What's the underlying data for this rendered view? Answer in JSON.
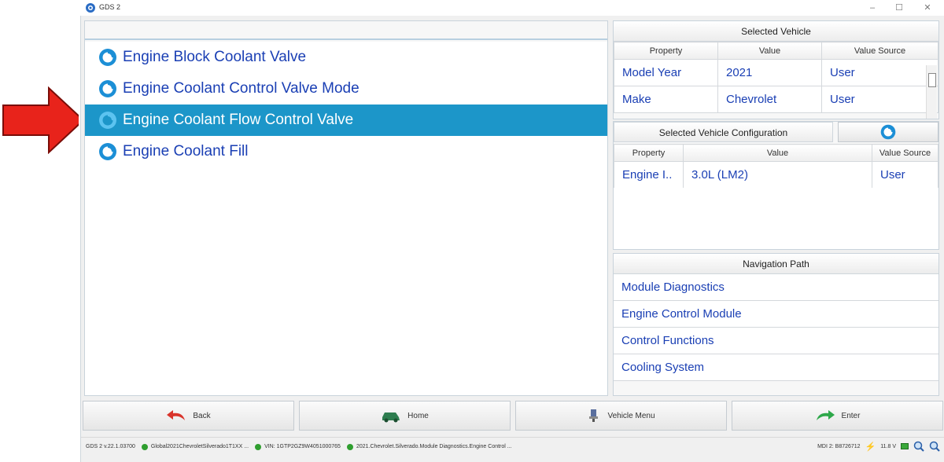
{
  "window": {
    "title": "GDS 2",
    "minimize": "–",
    "maximize": "☐",
    "close": "✕"
  },
  "list": {
    "items": [
      {
        "label": "Engine Block Coolant Valve",
        "selected": false
      },
      {
        "label": "Engine Coolant Control Valve Mode",
        "selected": false
      },
      {
        "label": "Engine Coolant Flow Control Valve",
        "selected": true
      },
      {
        "label": "Engine Coolant Fill",
        "selected": false
      }
    ]
  },
  "selected_vehicle": {
    "title": "Selected Vehicle",
    "columns": [
      "Property",
      "Value",
      "Value Source"
    ],
    "rows": [
      [
        "Model Year",
        "2021",
        "User"
      ],
      [
        "Make",
        "Chevrolet",
        "User"
      ]
    ]
  },
  "vehicle_config": {
    "title": "Selected Vehicle Configuration",
    "columns": [
      "Property",
      "Value",
      "Value Source"
    ],
    "rows": [
      [
        "Engine I..",
        "3.0L (LM2)",
        "User"
      ]
    ]
  },
  "navigation": {
    "title": "Navigation Path",
    "items": [
      "Module Diagnostics",
      "Engine Control Module",
      "Control Functions",
      "Cooling System"
    ]
  },
  "buttons": {
    "back": "Back",
    "home": "Home",
    "vehicle_menu": "Vehicle Menu",
    "enter": "Enter"
  },
  "status": {
    "version": "GDS 2 v.22.1.03700",
    "path": "Global2021ChevroletSilverado1T1XX ...",
    "vin": "VIN: 1GTP2GZ9W4051000765",
    "location": "2021.Chevrolet.Silverado.Module Diagnostics.Engine Control ...",
    "mdi": "MDI 2: B8726712",
    "voltage": "11.8 V"
  },
  "colors": {
    "accent": "#1c96c9",
    "link": "#1a3fb4",
    "arrow": "#e8231b",
    "status_ok": "#2f9e2f"
  }
}
